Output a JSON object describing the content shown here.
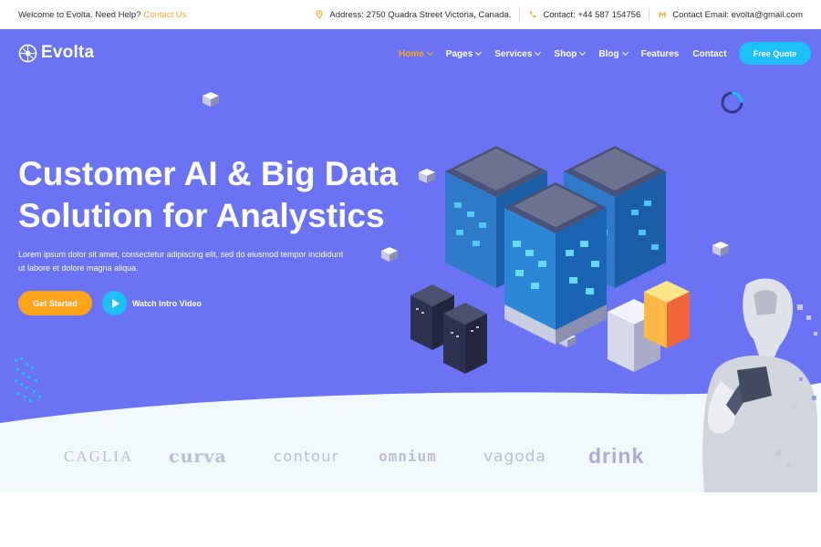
{
  "topbar": {
    "welcome_text": "Welcome to Evolta. Need Help?",
    "contact_link": "Contact Us",
    "address": "Address: 2750 Quadra Street Victoria, Canada.",
    "phone": "Contact: +44 587 154756",
    "email": "Contact Email: evolta@gmail.com",
    "icons": [
      "location-pin-icon",
      "phone-icon",
      "mail-icon"
    ]
  },
  "brand": {
    "name": "Evolta",
    "icon": "evolta-logo-icon"
  },
  "nav": {
    "items": [
      {
        "label": "Home",
        "dropdown": true,
        "active": true
      },
      {
        "label": "Pages",
        "dropdown": true
      },
      {
        "label": "Services",
        "dropdown": true
      },
      {
        "label": "Shop",
        "dropdown": true
      },
      {
        "label": "Blog",
        "dropdown": true
      },
      {
        "label": "Features",
        "dropdown": false
      },
      {
        "label": "Contact",
        "dropdown": false
      }
    ],
    "icons": [
      "cart-icon",
      "search-icon"
    ],
    "cta_label": "Free Quote"
  },
  "hero": {
    "title_line1": "Customer AI & Big Data",
    "title_line2": "Solution for Analystics",
    "desc_line1": "Lorem ipsum dolor sit amet, consectetur adipiscing elit, sed do eiusmod tempor incididunt",
    "desc_line2": "ut labore et dolore magna aliqua.",
    "primary_button": "Get Started",
    "video_button": "Watch Intro Video"
  },
  "brands": [
    "CAGLIA",
    "curva",
    "contour",
    "omnium",
    "vagoda",
    "drink"
  ],
  "colors": {
    "hero_bg": "#6b73f5",
    "accent_orange": "#ffa31a",
    "accent_cyan": "#1ec0f8",
    "brand_strip_bg": "#f1f9fb",
    "brand_text": "#b9bdd6"
  }
}
